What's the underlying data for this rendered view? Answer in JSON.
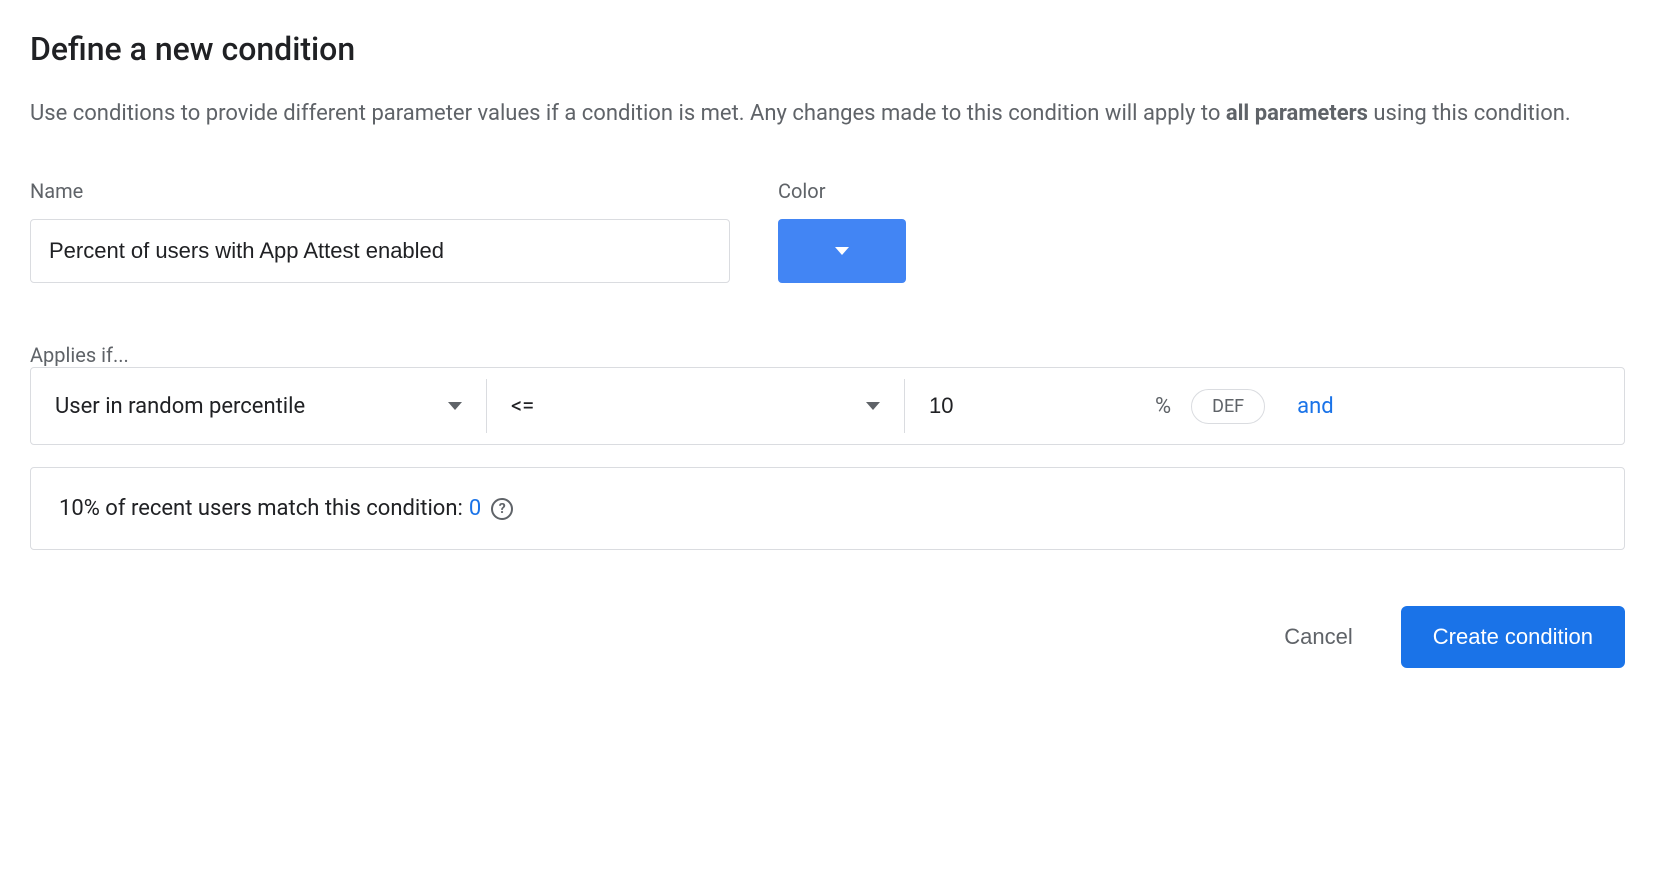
{
  "title": "Define a new condition",
  "description": {
    "text_before": "Use conditions to provide different parameter values if a condition is met. Any changes made to this condition will apply to ",
    "bold": "all parameters",
    "text_after": " using this condition."
  },
  "form": {
    "name_label": "Name",
    "name_value": "Percent of users with App Attest enabled",
    "color_label": "Color",
    "color_value": "#4285f4"
  },
  "applies": {
    "label": "Applies if...",
    "condition_type": "User in random percentile",
    "operator": "<=",
    "value": "10",
    "unit": "%",
    "chip": "DEF",
    "and_label": "and"
  },
  "match_info": {
    "text": "10% of recent users match this condition: ",
    "count": "0"
  },
  "buttons": {
    "cancel": "Cancel",
    "create": "Create condition"
  }
}
